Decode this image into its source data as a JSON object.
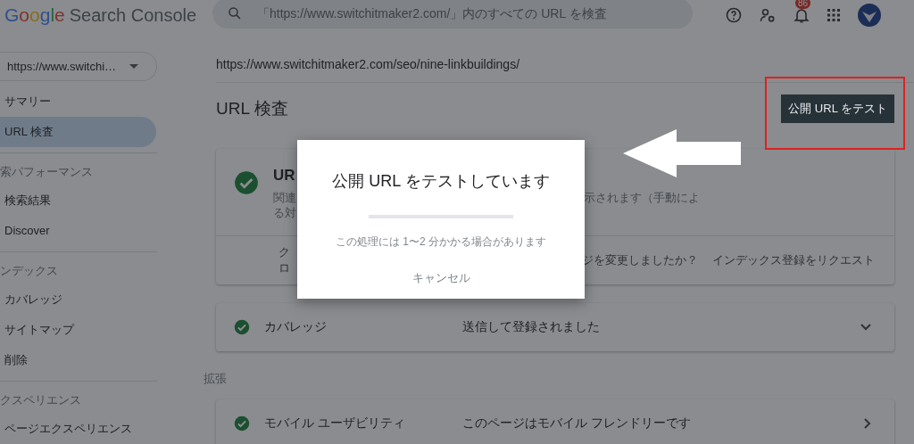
{
  "header": {
    "logo": "Google",
    "product": "Search Console",
    "search": {
      "placeholder": "「https://www.switchitmaker2.com/」内のすべての URL を検査"
    },
    "notification_count": "86"
  },
  "sidebar": {
    "property": "https://www.switchi…",
    "sections": [
      {
        "items": [
          {
            "label": "サマリー",
            "selected": false
          },
          {
            "label": "URL 検査",
            "selected": true
          }
        ]
      },
      {
        "label": "索パフォーマンス",
        "items": [
          {
            "label": "検索結果",
            "selected": false
          },
          {
            "label": "Discover",
            "selected": false
          }
        ]
      },
      {
        "label": "ンデックス",
        "items": [
          {
            "label": "カバレッジ",
            "selected": false
          },
          {
            "label": "サイトマップ",
            "selected": false
          },
          {
            "label": "削除",
            "selected": false
          }
        ]
      },
      {
        "label": "クスペリエンス",
        "items": [
          {
            "label": "ページエクスペリエンス",
            "selected": false
          }
        ]
      }
    ]
  },
  "main": {
    "url": "https://www.switchitmaker2.com/seo/nine-linkbuildings/",
    "title": "URL 検査",
    "test_button": "公開 URL をテスト",
    "status_card": {
      "title_fragment": "UR",
      "desc_left": [
        "関連",
        "る対"
      ],
      "desc_right": "示されます（手動によ",
      "footer_left": "クロ",
      "footer_right": "ジを変更しましたか？",
      "request_link": "インデックス登録をリクエスト"
    },
    "rows": [
      {
        "kind": "expand_row",
        "label": "カバレッジ",
        "value": "送信して登録されました"
      },
      {
        "kind": "heading",
        "label": "拡張"
      },
      {
        "kind": "link_row",
        "label": "モバイル ユーザビリティ",
        "value": "このページはモバイル フレンドリーです"
      }
    ]
  },
  "dialog": {
    "title": "公開 URL をテストしています",
    "progress": {
      "level": 1
    },
    "message": "この処理には 1〜2 分かかる場合があります",
    "cancel": "キャンセル"
  }
}
